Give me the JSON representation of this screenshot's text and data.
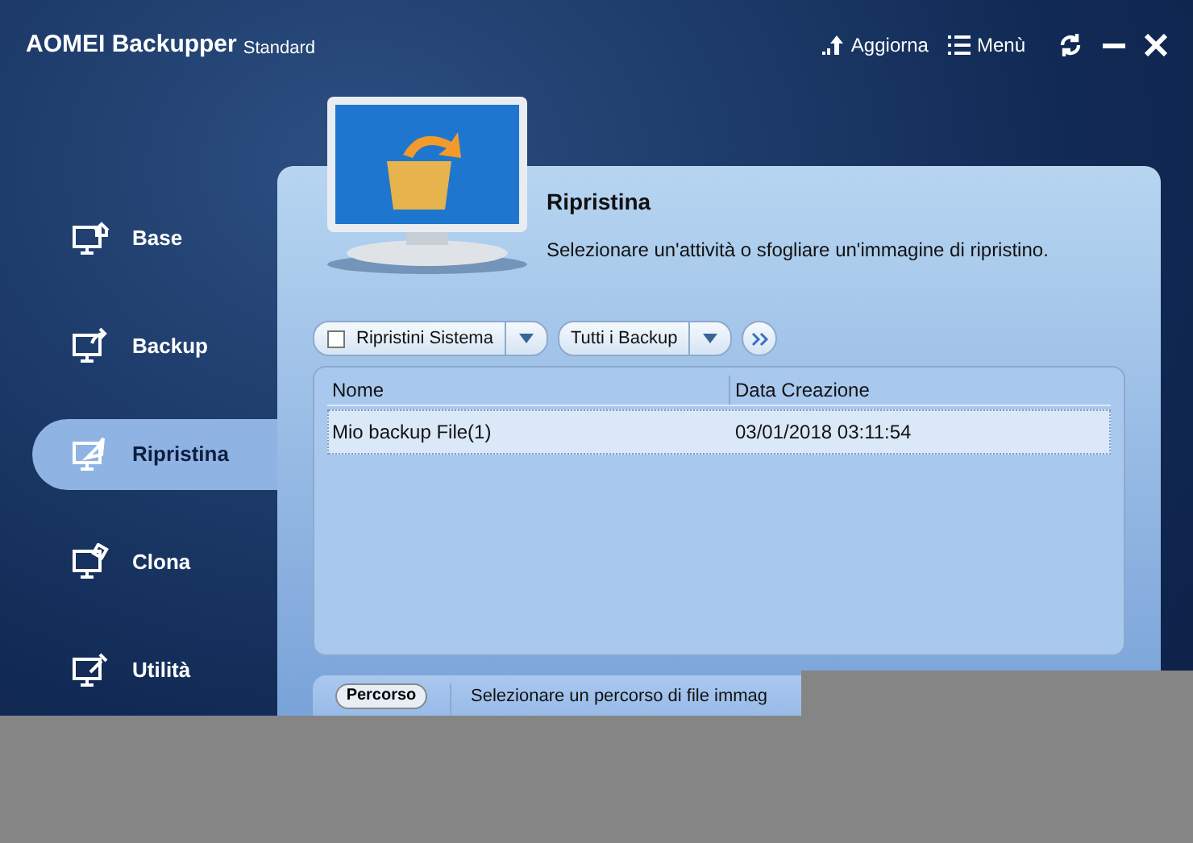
{
  "app": {
    "title": "AOMEI Backupper",
    "edition": "Standard"
  },
  "header_actions": [
    {
      "kind": "upgrade",
      "label": "Aggiorna"
    },
    {
      "kind": "menu",
      "label": "Menù"
    }
  ],
  "sidebar": {
    "items": [
      {
        "kind": "home",
        "label": "Base",
        "selected": false
      },
      {
        "kind": "backup",
        "label": "Backup",
        "selected": false
      },
      {
        "kind": "restore",
        "label": "Ripristina",
        "selected": true
      },
      {
        "kind": "clone",
        "label": "Clona",
        "selected": false
      },
      {
        "kind": "tools",
        "label": "Utilità",
        "selected": false
      }
    ]
  },
  "page": {
    "title": "Ripristina",
    "description": "Selezionare un'attività o sfogliare un'immagine di ripristino."
  },
  "filters": [
    {
      "kind": "checkbox",
      "label": "Ripristini Sistema",
      "checked": false
    },
    {
      "kind": "plain",
      "label": "Tutti i Backup"
    }
  ],
  "table": {
    "columns": [
      "Nome",
      "Data Creazione"
    ],
    "rows": [
      {
        "cells": [
          "Mio backup File(1)",
          "03/01/2018 03:11:54"
        ],
        "selected": true
      }
    ]
  },
  "path_bar": {
    "button": "Percorso",
    "text": "Selezionare un percorso di file immag"
  }
}
